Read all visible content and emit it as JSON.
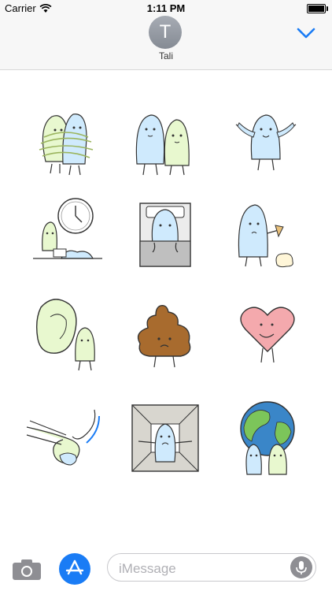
{
  "status": {
    "carrier": "Carrier",
    "time": "1:11 PM",
    "battery_level": 1.0
  },
  "header": {
    "avatar_initial": "T",
    "contact_name": "Tali"
  },
  "stickers": [
    {
      "name": "sticker-hugging-tied"
    },
    {
      "name": "sticker-two-friends"
    },
    {
      "name": "sticker-arms-open"
    },
    {
      "name": "sticker-clock-desk"
    },
    {
      "name": "sticker-in-bed"
    },
    {
      "name": "sticker-dropped-icecream"
    },
    {
      "name": "sticker-big-ear"
    },
    {
      "name": "sticker-poop"
    },
    {
      "name": "sticker-heart"
    },
    {
      "name": "sticker-hug-arms"
    },
    {
      "name": "sticker-box-room"
    },
    {
      "name": "sticker-holding-earth"
    }
  ],
  "compose": {
    "placeholder": "iMessage"
  },
  "icons": {
    "camera": "camera-icon",
    "appstore": "appstore-icon",
    "mic": "microphone-icon"
  },
  "colors": {
    "accent": "#1a7cf5",
    "blue_char": "#cfeafd",
    "green_char": "#e8f8cf",
    "poop": "#a86b2e",
    "heart": "#f4a9ad"
  }
}
